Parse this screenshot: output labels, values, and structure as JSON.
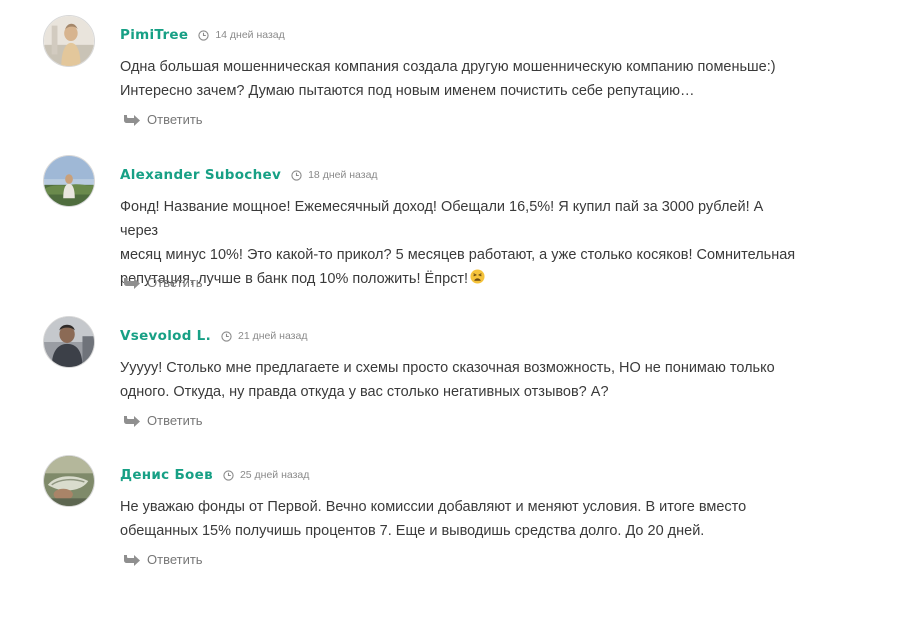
{
  "comments": [
    {
      "author": "PimiTree",
      "time": "14 дней назад",
      "lines": [
        "Одна большая мошенническая компания создала другую мошенническую компанию поменьше:)",
        "Интересно зачем? Думаю пытаются под новым именем почистить себе репутацию…"
      ],
      "reply_label": "Ответить",
      "avatar_icon": "user-photo-avatar"
    },
    {
      "author": "Alexander Subochev",
      "time": "18 дней назад",
      "lines": [
        "Фонд! Название мощное! Ежемесячный доход! Обещали 16,5%! Я купил пай за 3000 рублей! А через",
        "месяц минус 10%! Это какой-то прикол? 5 месяцев работают, а уже столько косяков! Сомнительная",
        "репутация, лучше в банк под 10% положить! Ёпрст!"
      ],
      "emoji": "tired-face-emoji",
      "reply_label": "Ответить",
      "avatar_icon": "user-photo-avatar"
    },
    {
      "author": "Vsevolod L.",
      "time": "21 дней назад",
      "lines": [
        "Ууууу! Столько мне предлагаете и схемы просто сказочная возможность, НО не понимаю только",
        "одного. Откуда, ну правда откуда у вас столько негативных отзывов? А?"
      ],
      "reply_label": "Ответить",
      "avatar_icon": "user-photo-avatar"
    },
    {
      "author": "Денис Боев",
      "time": "25 дней назад",
      "lines": [
        "Не уважаю фонды от Первой. Вечно комиссии добавляют и меняют условия. В итоге вместо",
        "обещанных 15% получишь процентов 7. Еще и выводишь средства долго. До 20 дней."
      ],
      "reply_label": "Ответить",
      "avatar_icon": "user-photo-avatar"
    }
  ],
  "colors": {
    "author": "#17a085",
    "text": "#3a3a3a",
    "meta": "#8a8a8a",
    "reply": "#777777"
  }
}
